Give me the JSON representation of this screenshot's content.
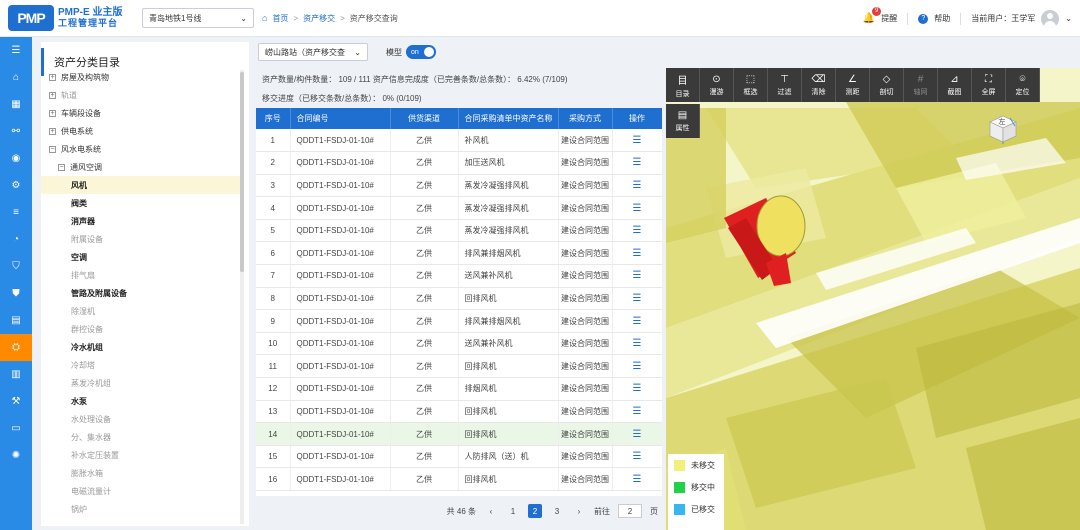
{
  "header": {
    "logo_mark": "PMP",
    "logo_line1": "PMP-E 业主版",
    "logo_line2": "工程管理平台",
    "project": "青岛地铁1号线",
    "breadcrumb": [
      "首页",
      "资产移交",
      "资产移交查询"
    ],
    "alerts_count": "9",
    "alerts_label": "提醒",
    "help_label": "帮助",
    "user_label": "当前用户：王学军"
  },
  "rail": {
    "icons": [
      "menu-icon",
      "home-icon",
      "grid-icon",
      "flow-icon",
      "camera-icon",
      "gear-icon",
      "sliders-icon",
      "pie-icon",
      "shield-icon",
      "user-shield-icon",
      "document-icon",
      "asset-icon",
      "chart-icon",
      "analysis-icon",
      "tv-icon",
      "settings-icon"
    ],
    "active_index": 11
  },
  "tree": {
    "title": "资产分类目录",
    "items": [
      {
        "label": "房屋及构筑物",
        "toggle": "+",
        "indent": 0,
        "style": "normal"
      },
      {
        "label": "轨道",
        "toggle": "+",
        "indent": 0,
        "style": "muted"
      },
      {
        "label": "车辆段设备",
        "toggle": "+",
        "indent": 0,
        "style": "normal"
      },
      {
        "label": "供电系统",
        "toggle": "+",
        "indent": 0,
        "style": "normal"
      },
      {
        "label": "风水电系统",
        "toggle": "−",
        "indent": 0,
        "style": "normal"
      },
      {
        "label": "通风空调",
        "toggle": "−",
        "indent": 1,
        "style": "normal"
      },
      {
        "label": "风机",
        "toggle": "",
        "indent": 2,
        "style": "bold",
        "selected": true
      },
      {
        "label": "阀类",
        "toggle": "",
        "indent": 2,
        "style": "bold"
      },
      {
        "label": "消声器",
        "toggle": "",
        "indent": 2,
        "style": "bold"
      },
      {
        "label": "附属设备",
        "toggle": "",
        "indent": 2,
        "style": "muted"
      },
      {
        "label": "空调",
        "toggle": "",
        "indent": 2,
        "style": "bold"
      },
      {
        "label": "排气扇",
        "toggle": "",
        "indent": 2,
        "style": "muted"
      },
      {
        "label": "管路及附属设备",
        "toggle": "",
        "indent": 2,
        "style": "bold"
      },
      {
        "label": "除湿机",
        "toggle": "",
        "indent": 2,
        "style": "muted"
      },
      {
        "label": "群控设备",
        "toggle": "",
        "indent": 2,
        "style": "muted"
      },
      {
        "label": "冷水机组",
        "toggle": "",
        "indent": 2,
        "style": "bold"
      },
      {
        "label": "冷却塔",
        "toggle": "",
        "indent": 2,
        "style": "muted"
      },
      {
        "label": "蒸发冷机组",
        "toggle": "",
        "indent": 2,
        "style": "muted"
      },
      {
        "label": "水泵",
        "toggle": "",
        "indent": 2,
        "style": "bold"
      },
      {
        "label": "水处理设备",
        "toggle": "",
        "indent": 2,
        "style": "muted"
      },
      {
        "label": "分、集水器",
        "toggle": "",
        "indent": 2,
        "style": "muted"
      },
      {
        "label": "补水定压装置",
        "toggle": "",
        "indent": 2,
        "style": "muted"
      },
      {
        "label": "膨胀水箱",
        "toggle": "",
        "indent": 2,
        "style": "muted"
      },
      {
        "label": "电磁流量计",
        "toggle": "",
        "indent": 2,
        "style": "muted"
      },
      {
        "label": "锅炉",
        "toggle": "",
        "indent": 2,
        "style": "muted"
      }
    ]
  },
  "filters": {
    "station": "崂山路站（资产移交查",
    "model_label": "模型",
    "switch_label": "on"
  },
  "stats": {
    "line1": "资产数量/构件数量：  109 / 111    资产信息完成度（已完善条数/总条数）：  6.42%  (7/109)",
    "line2": "移交进度（已移交条数/总条数）：  0%  (0/109)"
  },
  "table": {
    "columns": [
      "序号",
      "合同编号",
      "供货渠道",
      "合同采购清单中资产名称",
      "采购方式",
      "操作"
    ],
    "rows": [
      [
        "1",
        "QDDT1-FSDJ-01-10#",
        "乙供",
        "补风机",
        "建设合同范围"
      ],
      [
        "2",
        "QDDT1-FSDJ-01-10#",
        "乙供",
        "加压送风机",
        "建设合同范围"
      ],
      [
        "3",
        "QDDT1-FSDJ-01-10#",
        "乙供",
        "蒸发冷凝强排风机",
        "建设合同范围"
      ],
      [
        "4",
        "QDDT1-FSDJ-01-10#",
        "乙供",
        "蒸发冷凝强排风机",
        "建设合同范围"
      ],
      [
        "5",
        "QDDT1-FSDJ-01-10#",
        "乙供",
        "蒸发冷凝强排风机",
        "建设合同范围"
      ],
      [
        "6",
        "QDDT1-FSDJ-01-10#",
        "乙供",
        "排风兼排烟风机",
        "建设合同范围"
      ],
      [
        "7",
        "QDDT1-FSDJ-01-10#",
        "乙供",
        "送风兼补风机",
        "建设合同范围"
      ],
      [
        "8",
        "QDDT1-FSDJ-01-10#",
        "乙供",
        "回排风机",
        "建设合同范围"
      ],
      [
        "9",
        "QDDT1-FSDJ-01-10#",
        "乙供",
        "排风兼排烟风机",
        "建设合同范围"
      ],
      [
        "10",
        "QDDT1-FSDJ-01-10#",
        "乙供",
        "送风兼补风机",
        "建设合同范围"
      ],
      [
        "11",
        "QDDT1-FSDJ-01-10#",
        "乙供",
        "回排风机",
        "建设合同范围"
      ],
      [
        "12",
        "QDDT1-FSDJ-01-10#",
        "乙供",
        "排烟风机",
        "建设合同范围"
      ],
      [
        "13",
        "QDDT1-FSDJ-01-10#",
        "乙供",
        "回排风机",
        "建设合同范围"
      ],
      [
        "14",
        "QDDT1-FSDJ-01-10#",
        "乙供",
        "回排风机",
        "建设合同范围"
      ],
      [
        "15",
        "QDDT1-FSDJ-01-10#",
        "乙供",
        "人防排风（送）机",
        "建设合同范围"
      ],
      [
        "16",
        "QDDT1-FSDJ-01-10#",
        "乙供",
        "回排风机",
        "建设合同范围"
      ]
    ],
    "highlighted_row": 13
  },
  "pagination": {
    "total": "共 46 条",
    "prev": "‹",
    "pages": [
      "1",
      "2",
      "3"
    ],
    "active_page": "2",
    "next": "›",
    "goto_label": "前往",
    "goto_value": "2",
    "page_suffix": "页"
  },
  "viewer": {
    "tools": [
      {
        "label": "目录",
        "icon": "目"
      },
      {
        "label": "漫游",
        "icon": "⊙"
      },
      {
        "label": "框选",
        "icon": "⬚"
      },
      {
        "label": "过滤",
        "icon": "⊤"
      },
      {
        "label": "清除",
        "icon": "⌫"
      },
      {
        "label": "测距",
        "icon": "∠"
      },
      {
        "label": "剖切",
        "icon": "◇"
      },
      {
        "label": "轴网",
        "icon": "#",
        "disabled": true
      },
      {
        "label": "截图",
        "icon": "⊿"
      },
      {
        "label": "全屏",
        "icon": "⛶"
      },
      {
        "label": "定位",
        "icon": "⌾"
      }
    ],
    "props_tool": {
      "label": "属性",
      "icon": "▤"
    },
    "cube_label": "左",
    "legend": [
      {
        "label": "未移交",
        "color": "#f0f07a"
      },
      {
        "label": "移交中",
        "color": "#22d14a"
      },
      {
        "label": "已移交",
        "color": "#38b6f0"
      }
    ]
  }
}
